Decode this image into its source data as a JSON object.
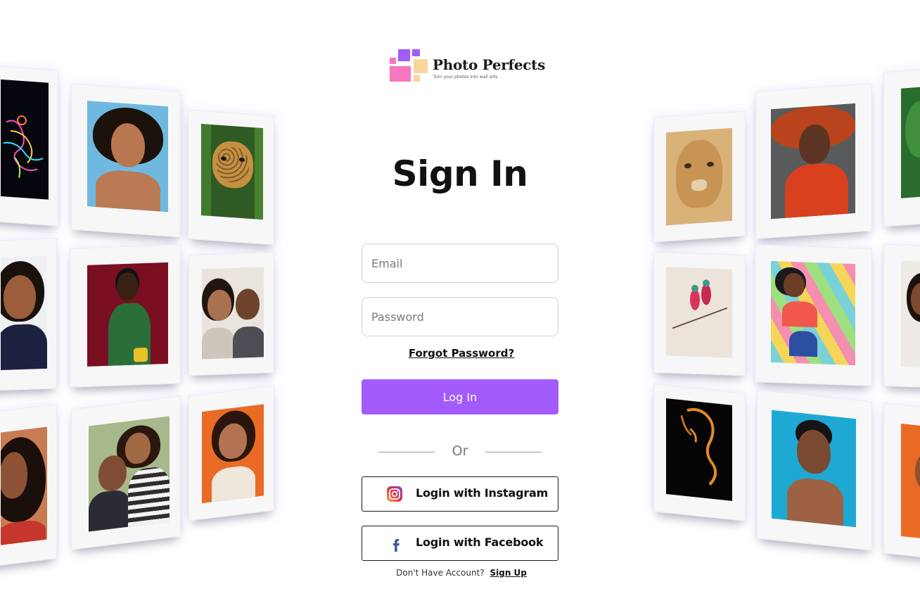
{
  "brand": {
    "name": "Photo Perfects",
    "tagline": "Turn your photos into wall arts.",
    "colors": {
      "purple": "#a35cfb",
      "pink": "#f777c0",
      "peach": "#fbd59a"
    }
  },
  "form": {
    "title": "Sign In",
    "email_placeholder": "Email",
    "password_placeholder": "Password",
    "forgot_label": "Forgot Password?",
    "login_label": "Log In",
    "divider_label": "Or",
    "instagram_label": "Login with Instagram",
    "facebook_label": "Login with Facebook",
    "signup_prompt": "Don't Have Account?",
    "signup_link": "Sign Up"
  },
  "gallery": {
    "left": [
      "neon-dancer-art",
      "laughing-woman-afro",
      "jaguar",
      "smiling-woman-braids",
      "woman-red-background",
      "smiling-couple",
      "woman-curly-hair",
      "hugging-couple",
      "woman-orange-background"
    ],
    "right": [
      "lioness",
      "woman-red-hat",
      "tropical-leaves",
      "bee-eater-birds",
      "woman-colorful-floor",
      "woman-portrait-partial",
      "silhouette-orange-light",
      "woman-blue-background",
      "woman-orange-partial"
    ]
  }
}
